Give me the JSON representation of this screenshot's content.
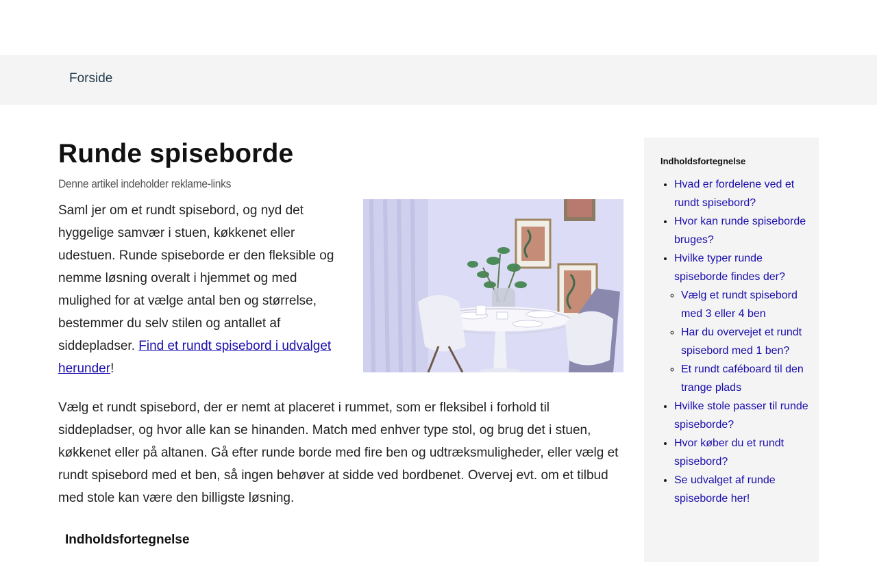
{
  "nav": {
    "home_label": "Forside"
  },
  "article": {
    "title": "Runde spiseborde",
    "disclaimer": "Denne artikel indeholder reklame-links",
    "intro_text": "Saml jer om et rundt spisebord, og nyd det hyggelige samvær i stuen, køkkenet eller udestuen. Runde spiseborde er den fleksible og nemme løsning overalt i hjemmet og med mulighed for at vælge antal ben og størrelse, bestemmer du selv stilen og antallet af siddepladser. ",
    "intro_link": "Find et rundt spisebord i udvalget herunder",
    "intro_after_link": "!",
    "paragraph2": "Vælg et rundt spisebord, der er nemt at placeret i rummet, som er fleksibel i forhold til siddepladser, og hvor alle kan se hinanden. Match med enhver type stol, og brug det i stuen, køkkenet eller på altanen. Gå efter runde borde med fire ben og udtræksmuligheder, eller vælg et rundt spisebord med et ben, så ingen behøver at sidde ved bordbenet. Overvej evt. om et tilbud med stole kan være den billigste løsning.",
    "toc_heading": "Indholdsfortegnelse"
  },
  "sidebar": {
    "title": "Indholdsfortegnelse",
    "items": [
      {
        "label": "Hvad er fordelene ved et rundt spisebord?"
      },
      {
        "label": "Hvor kan runde spiseborde bruges?"
      },
      {
        "label": "Hvilke typer runde spiseborde findes der?"
      },
      {
        "label": "Hvilke stole passer til runde spiseborde?"
      },
      {
        "label": "Hvor køber du et rundt spisebord?"
      },
      {
        "label": "Se udvalget af runde spiseborde her!"
      }
    ],
    "subitems": [
      {
        "label": "Vælg et rundt spisebord med 3 eller 4 ben"
      },
      {
        "label": "Har du overvejet et rundt spisebord med 1 ben?"
      },
      {
        "label": "Et rundt caféboard til den trange plads"
      }
    ]
  }
}
